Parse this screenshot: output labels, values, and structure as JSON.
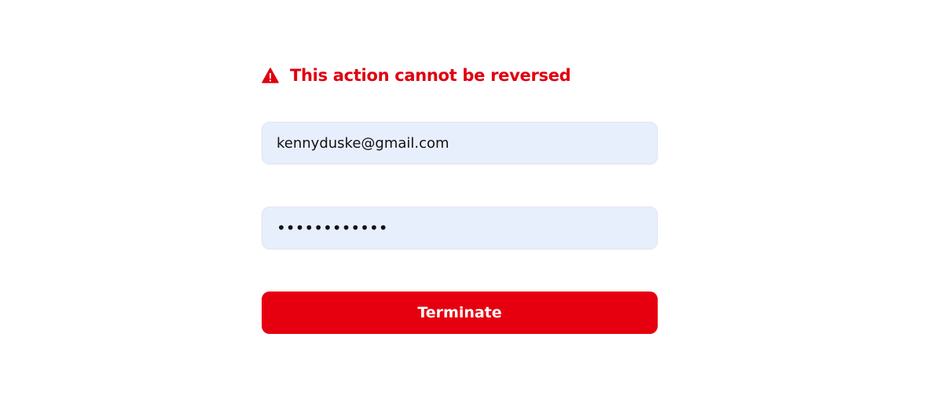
{
  "warning": {
    "icon": "warning-triangle-icon",
    "text": "This action cannot be reversed",
    "color": "#e0000f"
  },
  "form": {
    "email_value": "kennyduske@gmail.com",
    "password_value": "••••••••••••"
  },
  "terminate_button": {
    "label": "Terminate",
    "color": "#e6000f"
  },
  "colors": {
    "field_background": "#e8effc",
    "page_background": "#ffffff"
  }
}
